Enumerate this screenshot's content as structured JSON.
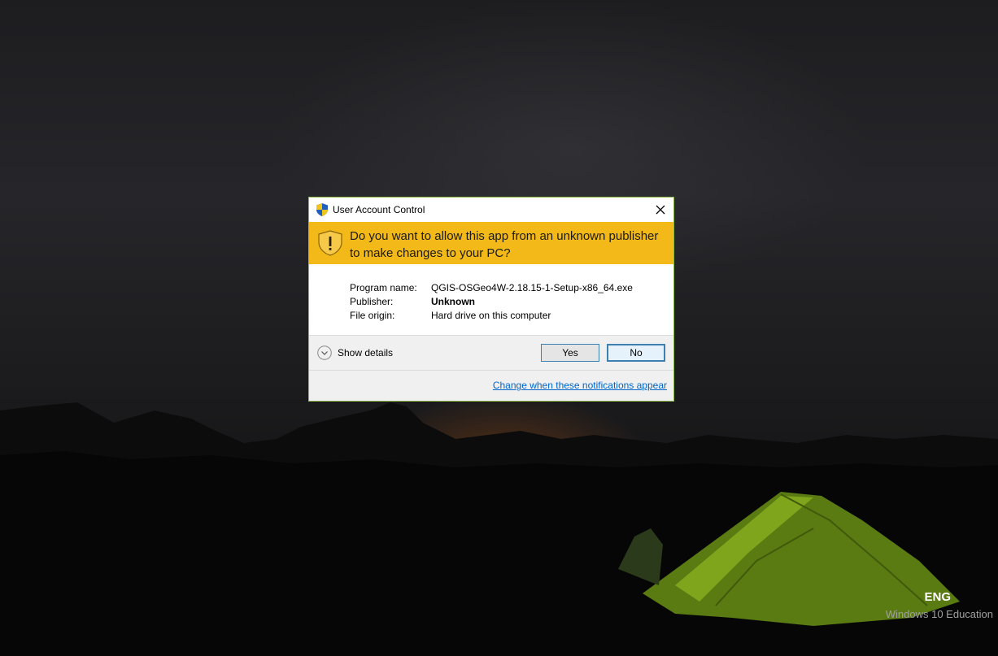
{
  "dialog": {
    "title": "User Account Control",
    "question": "Do you want to allow this app from an unknown publisher to make changes to your PC?",
    "details": [
      {
        "label": "Program name:",
        "value": "QGIS-OSGeo4W-2.18.15-1-Setup-x86_64.exe",
        "bold": false
      },
      {
        "label": "Publisher:",
        "value": "Unknown",
        "bold": true
      },
      {
        "label": "File origin:",
        "value": "Hard drive on this computer",
        "bold": false
      }
    ],
    "show_details_label": "Show details",
    "yes_label": "Yes",
    "no_label": "No",
    "change_link": "Change when these notifications appear",
    "banner_color": "#f3b919",
    "link_color": "#0066cc"
  },
  "desktop": {
    "language": "ENG",
    "edition": "Windows 10 Education"
  }
}
